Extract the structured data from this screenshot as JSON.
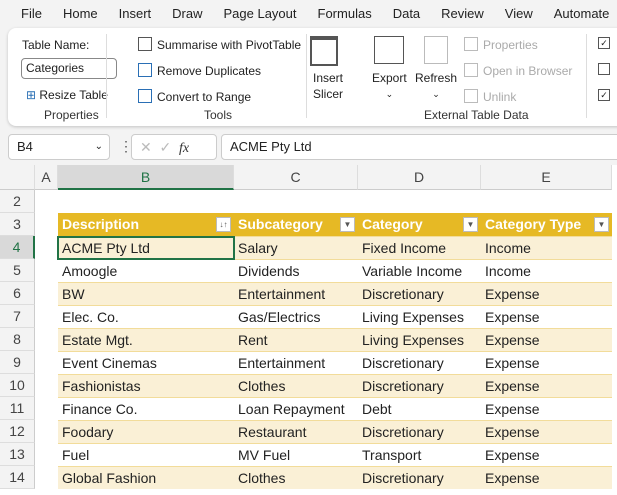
{
  "menu": [
    "File",
    "Home",
    "Insert",
    "Draw",
    "Page Layout",
    "Formulas",
    "Data",
    "Review",
    "View",
    "Automate"
  ],
  "ribbon": {
    "table_name_label": "Table Name:",
    "table_name_value": "Categories",
    "resize_table": "Resize Table",
    "properties_group": "Properties",
    "summarise_pivot": "Summarise with PivotTable",
    "remove_duplicates": "Remove Duplicates",
    "convert_to_range": "Convert to Range",
    "tools_group": "Tools",
    "insert_slicer_1": "Insert",
    "insert_slicer_2": "Slicer",
    "export": "Export",
    "refresh": "Refresh",
    "properties": "Properties",
    "open_in_browser": "Open in Browser",
    "unlink": "Unlink",
    "external_group": "External Table Data"
  },
  "formula_bar": {
    "name_box": "B4",
    "formula": "ACME Pty Ltd"
  },
  "columns": [
    "A",
    "B",
    "C",
    "D",
    "E"
  ],
  "rows": [
    "2",
    "3",
    "4",
    "5",
    "6",
    "7",
    "8",
    "9",
    "10",
    "11",
    "12",
    "13",
    "14"
  ],
  "table": {
    "headers": [
      "Description",
      "Subcategory",
      "Category",
      "Category Type"
    ],
    "data": [
      [
        "ACME Pty Ltd",
        "Salary",
        "Fixed Income",
        "Income"
      ],
      [
        "Amoogle",
        "Dividends",
        "Variable Income",
        "Income"
      ],
      [
        "BW",
        "Entertainment",
        "Discretionary",
        "Expense"
      ],
      [
        "Elec. Co.",
        "Gas/Electrics",
        "Living Expenses",
        "Expense"
      ],
      [
        "Estate Mgt.",
        "Rent",
        "Living Expenses",
        "Expense"
      ],
      [
        "Event Cinemas",
        "Entertainment",
        "Discretionary",
        "Expense"
      ],
      [
        "Fashionistas",
        "Clothes",
        "Discretionary",
        "Expense"
      ],
      [
        "Finance Co.",
        "Loan Repayment",
        "Debt",
        "Expense"
      ],
      [
        "Foodary",
        "Restaurant",
        "Discretionary",
        "Expense"
      ],
      [
        "Fuel",
        "MV Fuel",
        "Transport",
        "Expense"
      ],
      [
        "Global Fashion",
        "Clothes",
        "Discretionary",
        "Expense"
      ]
    ]
  }
}
